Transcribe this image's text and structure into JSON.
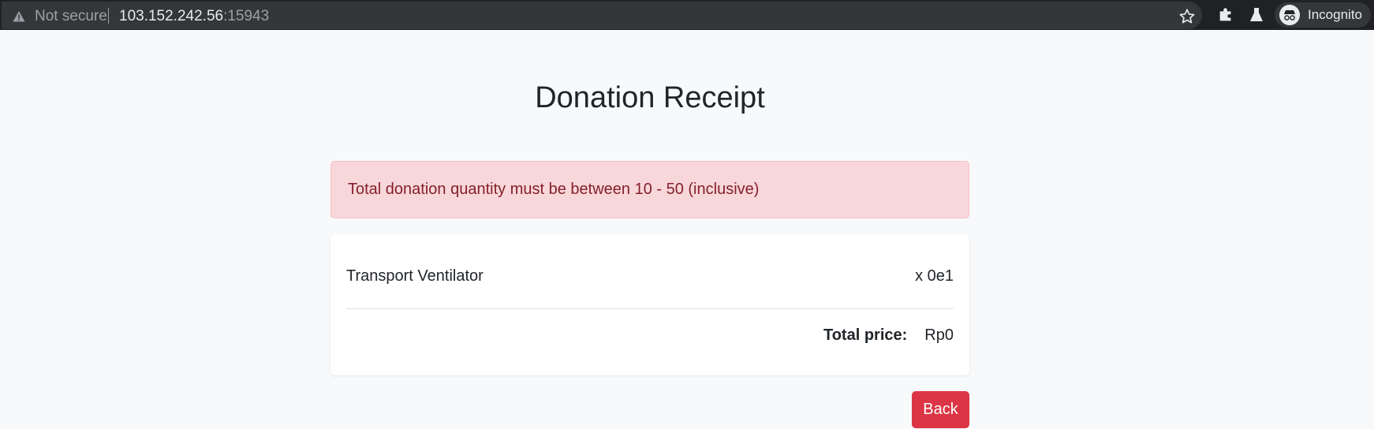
{
  "browser": {
    "security_label": "Not secure",
    "url_host": "103.152.242.56",
    "url_port": ":15943",
    "profile_label": "Incognito",
    "icons": [
      "warning-icon",
      "star-icon",
      "puzzle-icon",
      "flask-icon",
      "incognito-icon"
    ]
  },
  "page": {
    "title": "Donation Receipt",
    "alert": "Total donation quantity must be between 10 - 50 (inclusive)",
    "item": {
      "name": "Transport Ventilator",
      "quantity": "x 0e1"
    },
    "total": {
      "label": "Total price:",
      "value": "Rp0"
    },
    "back_label": "Back"
  },
  "colors": {
    "alert_bg": "#f8d7da",
    "alert_text": "#842029",
    "button_bg": "#dc3545",
    "page_bg": "#f8f9fa"
  }
}
